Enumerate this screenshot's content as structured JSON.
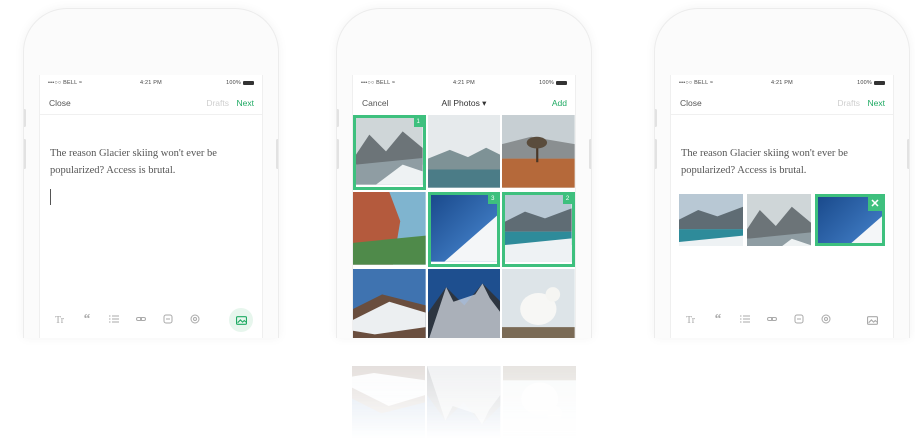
{
  "colors": {
    "accent": "#1faa63",
    "selection": "#3ec07e",
    "muted_text": "#cfcfcf"
  },
  "status": {
    "carrier": "•••○○ BELL ≈",
    "time": "4:21 PM",
    "battery": "100%"
  },
  "screen1": {
    "nav": {
      "close": "Close",
      "drafts": "Drafts",
      "next": "Next"
    },
    "text": "The reason Glacier skiing won't ever be popularized? Access is brutal.",
    "toolbar": [
      "text-format-icon",
      "quote-icon",
      "list-icon",
      "link-icon",
      "mention-icon",
      "emoji-icon",
      "photo-icon"
    ],
    "toolbar_labels": {
      "text_format": "Tr",
      "quote": "“"
    }
  },
  "screen2": {
    "nav": {
      "cancel": "Cancel",
      "album": "All Photos ▾",
      "add": "Add"
    },
    "photos": [
      {
        "name": "snowy-mountain-lake",
        "selected": true,
        "badge": "1"
      },
      {
        "name": "misty-lake",
        "selected": false
      },
      {
        "name": "autumn-tree-field",
        "selected": false
      },
      {
        "name": "red-canyon-cliff",
        "selected": false
      },
      {
        "name": "blue-sky-snow-slope",
        "selected": true,
        "badge": "3"
      },
      {
        "name": "snowy-valley-lake",
        "selected": true,
        "badge": "2"
      },
      {
        "name": "snowy-ridge-sunset",
        "selected": false
      },
      {
        "name": "dark-mountain-peaks",
        "selected": false
      },
      {
        "name": "mountain-goat",
        "selected": false
      }
    ]
  },
  "screen3": {
    "nav": {
      "close": "Close",
      "drafts": "Drafts",
      "next": "Next"
    },
    "text": "The reason Glacier skiing won't ever be popularized? Access is brutal.",
    "attached": [
      "snowy-valley-lake",
      "snowy-mountain-lake",
      "blue-sky-snow-slope"
    ],
    "remove_label": "✕",
    "toolbar_labels": {
      "text_format": "Tr",
      "quote": "“"
    }
  }
}
